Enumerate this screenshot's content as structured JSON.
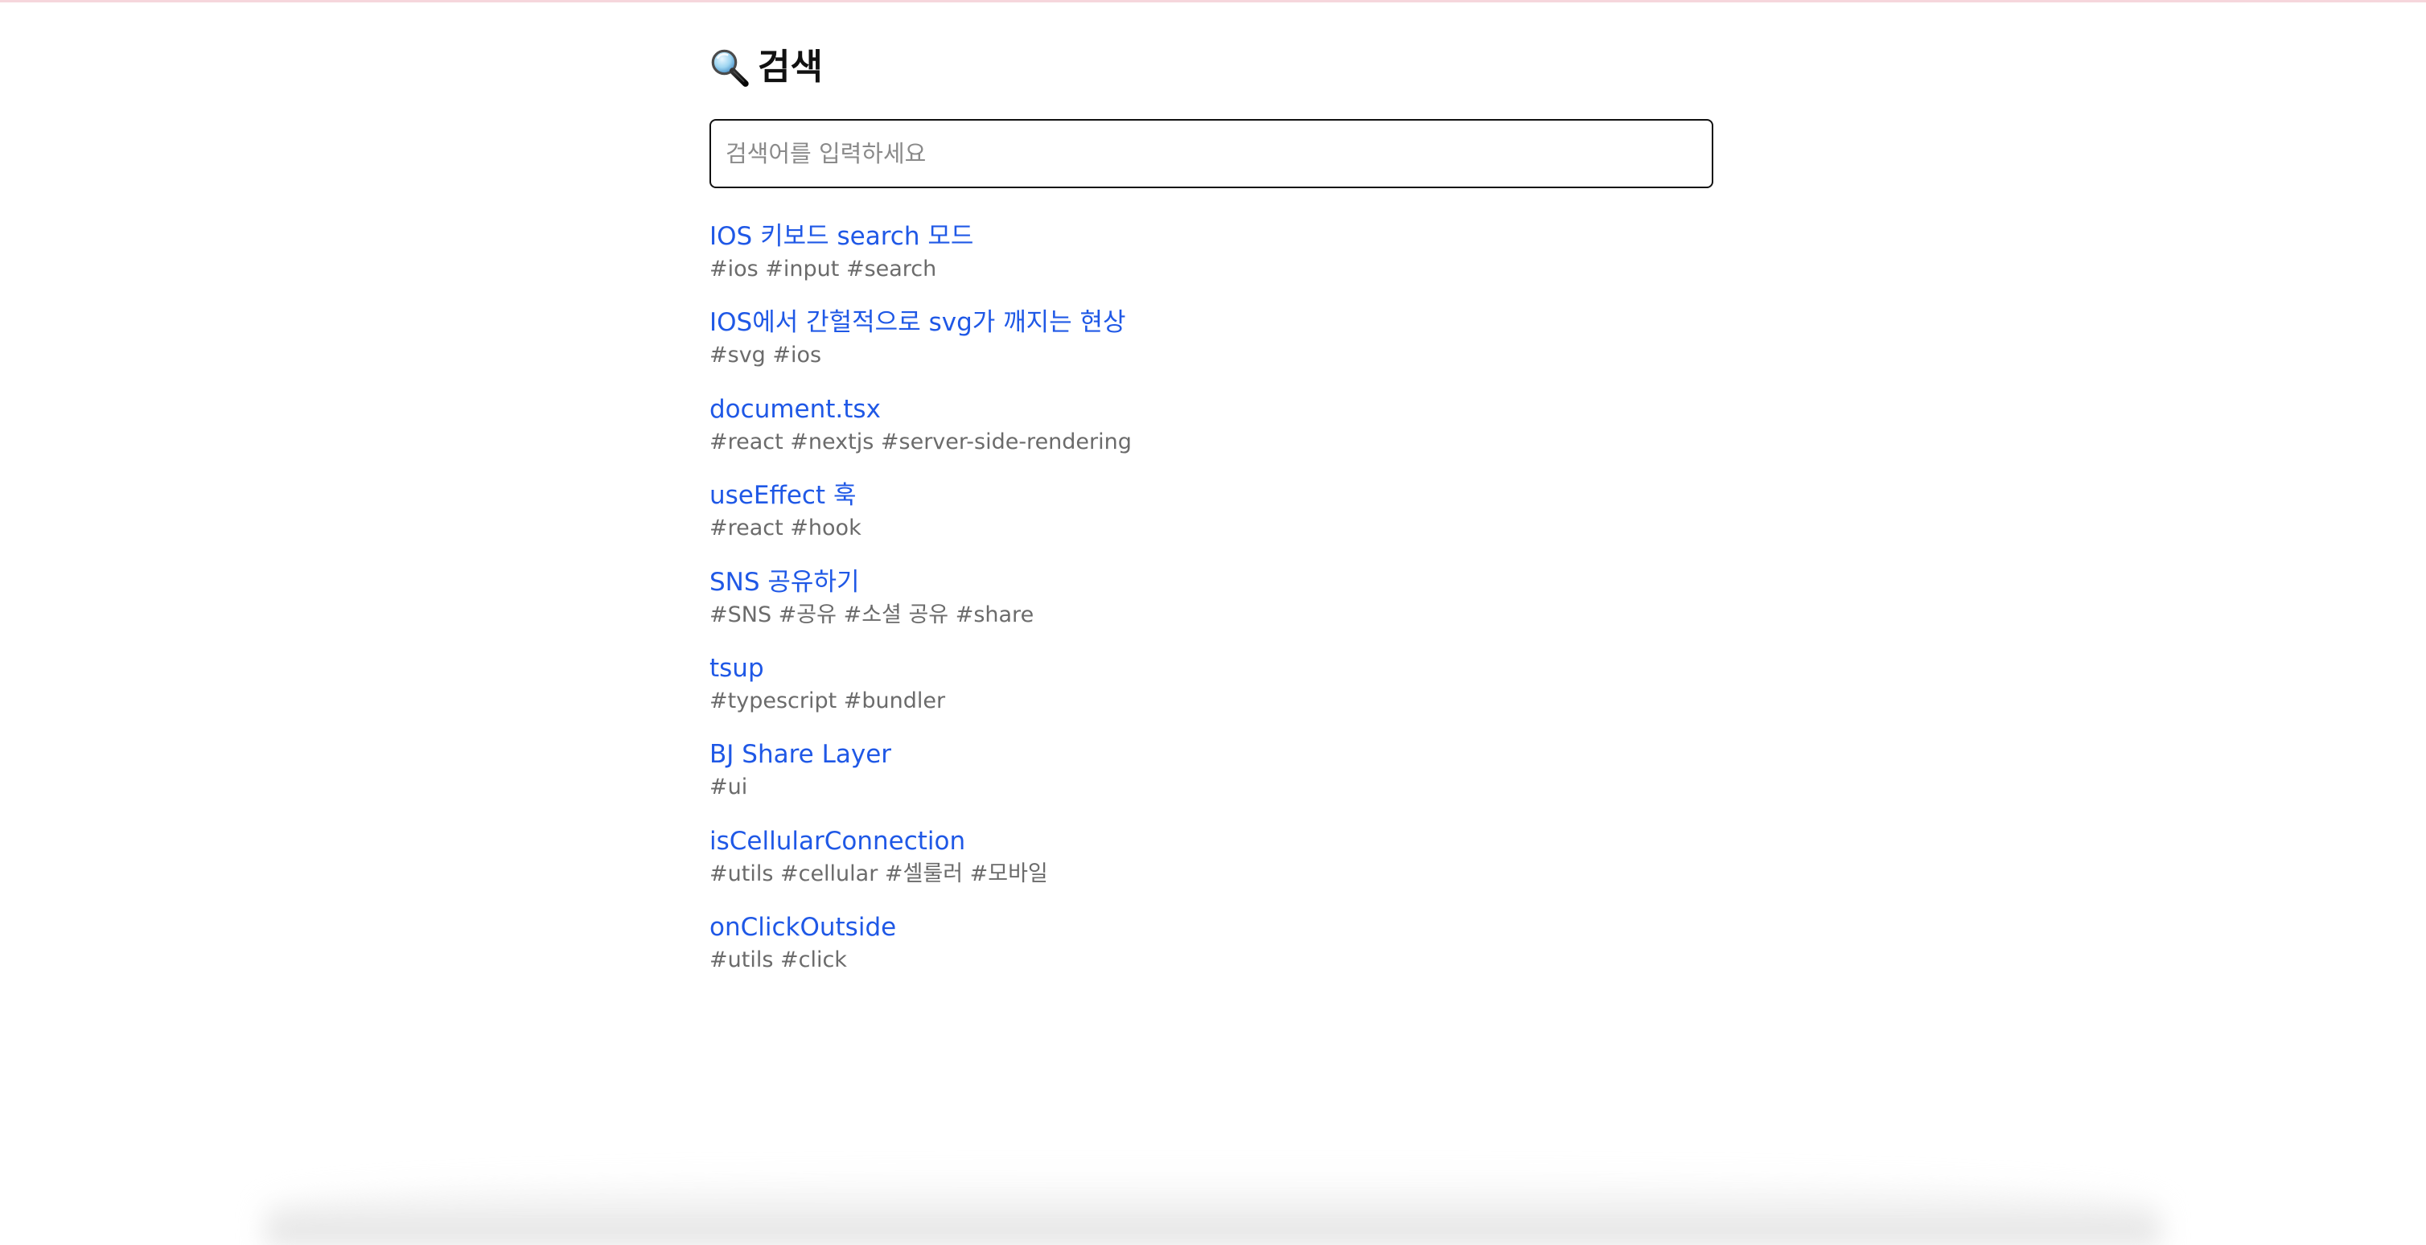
{
  "page": {
    "title": "검색",
    "title_icon": "magnifying-glass-icon",
    "accent_color": "#1f58e6",
    "tag_color": "#6b6b6b"
  },
  "search": {
    "value": "",
    "placeholder": "검색어를 입력하세요"
  },
  "results": [
    {
      "title": "IOS 키보드 search 모드",
      "tags": "#ios #input #search"
    },
    {
      "title": "IOS에서 간헐적으로 svg가 깨지는 현상",
      "tags": "#svg #ios"
    },
    {
      "title": "document.tsx",
      "tags": "#react #nextjs #server-side-rendering"
    },
    {
      "title": "useEffect 훅",
      "tags": "#react #hook"
    },
    {
      "title": "SNS 공유하기",
      "tags": "#SNS #공유 #소셜 공유 #share"
    },
    {
      "title": "tsup",
      "tags": "#typescript #bundler"
    },
    {
      "title": "BJ Share Layer",
      "tags": "#ui"
    },
    {
      "title": "isCellularConnection",
      "tags": "#utils #cellular #셀룰러 #모바일"
    },
    {
      "title": "onClickOutside",
      "tags": "#utils #click"
    }
  ]
}
